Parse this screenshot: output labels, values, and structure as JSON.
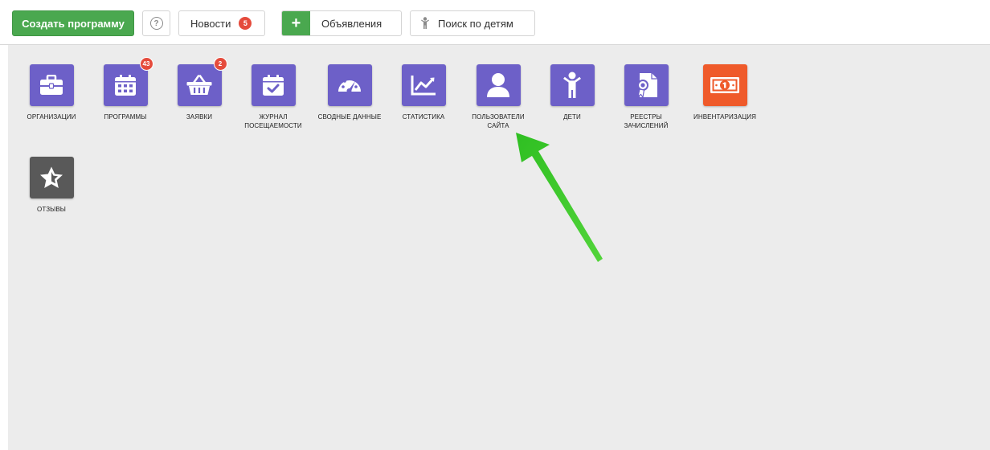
{
  "toolbar": {
    "create_label": "Создать программу",
    "help_symbol": "?",
    "news_label": "Новости",
    "news_count": "5",
    "ads_plus": "+",
    "ads_label": "Объявления",
    "search_children_label": "Поиск по детям"
  },
  "tiles": [
    {
      "label": "ОРГАНИЗАЦИИ",
      "icon": "briefcase-icon",
      "badge": ""
    },
    {
      "label": "ПРОГРАММЫ",
      "icon": "calendar-icon",
      "badge": "43"
    },
    {
      "label": "ЗАЯВКИ",
      "icon": "basket-icon",
      "badge": "2"
    },
    {
      "label": "ЖУРНАЛ ПОСЕЩАЕМОСТИ",
      "icon": "calendar-check-icon",
      "badge": ""
    },
    {
      "label": "СВОДНЫЕ ДАННЫЕ",
      "icon": "dashboard-gauge-icon",
      "badge": ""
    },
    {
      "label": "СТАТИСТИКА",
      "icon": "line-chart-icon",
      "badge": ""
    },
    {
      "label": "ПОЛЬЗОВАТЕЛИ САЙТА",
      "icon": "user-icon",
      "badge": ""
    },
    {
      "label": "ДЕТИ",
      "icon": "child-icon",
      "badge": ""
    },
    {
      "label": "РЕЕСТРЫ ЗАЧИСЛЕНИЙ",
      "icon": "certificate-document-icon",
      "badge": ""
    },
    {
      "label": "ИНВЕНТАРИЗАЦИЯ",
      "icon": "money-bill-icon",
      "badge": ""
    },
    {
      "label": "ОТЗЫВЫ",
      "icon": "star-icon",
      "badge": ""
    }
  ],
  "colors": {
    "accent_green": "#4aa84f",
    "tile_purple": "#6d60c8",
    "tile_orange": "#ef5a2a",
    "tile_gray": "#595959",
    "badge_red": "#e54b3c",
    "annotation_arrow": "#3fc928"
  }
}
